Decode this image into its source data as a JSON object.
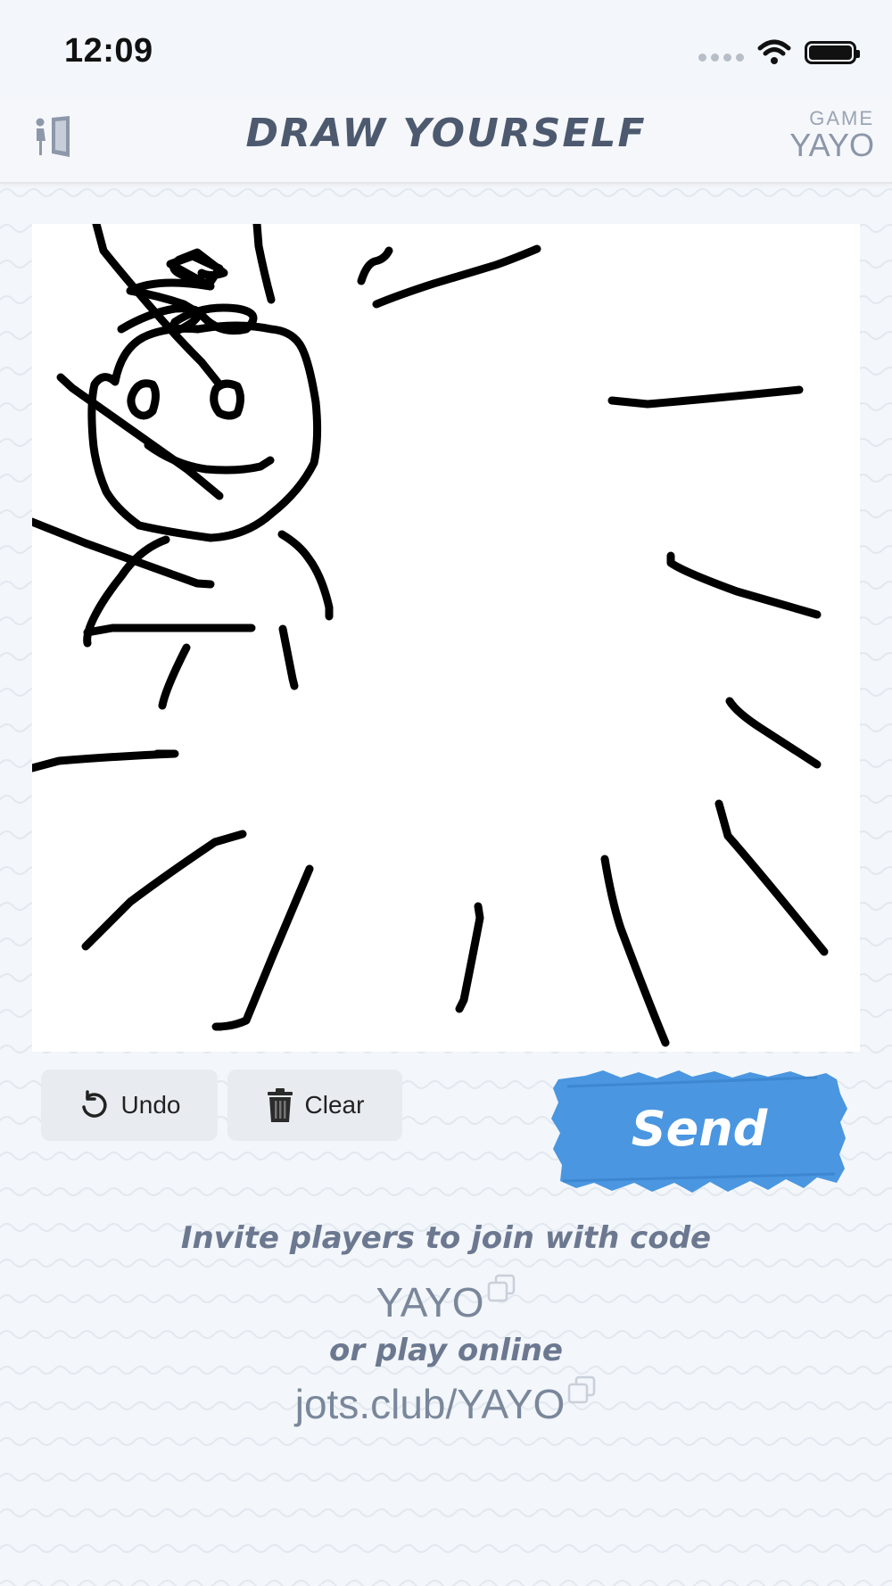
{
  "status_bar": {
    "time": "12:09"
  },
  "header": {
    "title": "DRAW YOURSELF",
    "game_label": "GAME",
    "game_code": "YAYO"
  },
  "toolbar": {
    "undo_label": "Undo",
    "clear_label": "Clear",
    "send_label": "Send"
  },
  "invite": {
    "prompt": "Invite players to join with code",
    "code": "YAYO",
    "or_text": "or play online",
    "url": "jots.club/YAYO"
  },
  "colors": {
    "send_blue": "#4a96e0",
    "header_text": "#4d596e",
    "muted_text": "#7a879b"
  },
  "icons": [
    "exit-door-icon",
    "wifi-icon",
    "battery-icon",
    "undo-icon",
    "trash-icon",
    "copy-icon"
  ]
}
